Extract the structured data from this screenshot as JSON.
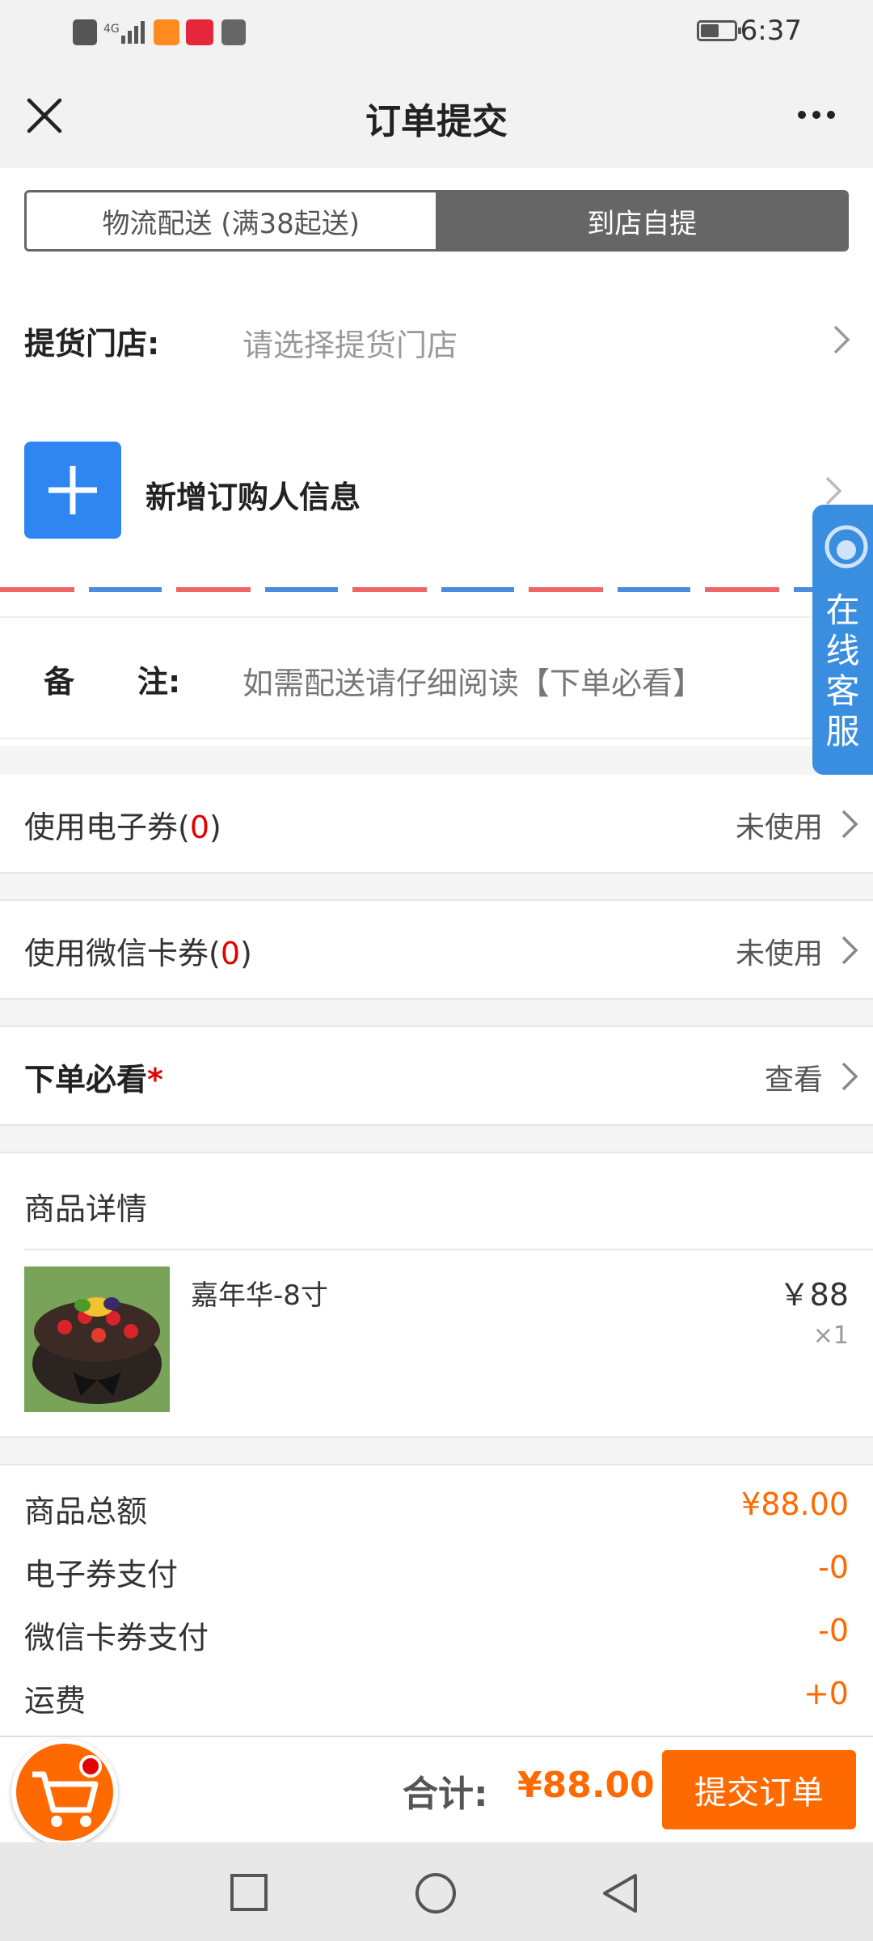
{
  "status_bar": {
    "time": "6:37",
    "icons": [
      "hd-icon",
      "4g-signal-icon",
      "video-app-icon",
      "app-icon",
      "hms-icon",
      "battery-icon"
    ]
  },
  "header": {
    "title": "订单提交",
    "close_icon": "close-icon",
    "more_icon": "more-icon"
  },
  "delivery_tabs": {
    "delivery": "物流配送 (满38起送)",
    "pickup": "到店自提",
    "selected": "pickup"
  },
  "pickup_store": {
    "label": "提货门店:",
    "placeholder": "请选择提货门店"
  },
  "buyer": {
    "label": "新增订购人信息"
  },
  "remark": {
    "label_a": "备",
    "label_b": "注:",
    "placeholder": "如需配送请仔细阅读【下单必看】"
  },
  "coupons": [
    {
      "label": "使用电子券(",
      "count": "0",
      "close": ")",
      "status": "未使用"
    },
    {
      "label": "使用微信卡券(",
      "count": "0",
      "close": ")",
      "status": "未使用"
    }
  ],
  "must_read": {
    "label": "下单必看",
    "required_mark": "*",
    "action": "查看"
  },
  "product_section": {
    "title": "商品详情",
    "items": [
      {
        "name": "嘉年华-8寸",
        "price": "￥88",
        "qty": "×1"
      }
    ]
  },
  "summary": [
    {
      "label": "商品总额",
      "value": "¥88.00"
    },
    {
      "label": "电子券支付",
      "value": "-0"
    },
    {
      "label": "微信卡券支付",
      "value": "-0"
    },
    {
      "label": "运费",
      "value": "+0"
    }
  ],
  "customer_service": {
    "label": "在线客服"
  },
  "bottom_bar": {
    "total_label": "合计:",
    "total_value": "¥88.00",
    "submit": "提交订单"
  },
  "colors": {
    "accent": "#ff6a00",
    "blue": "#3a8ee0",
    "required": "#e20000"
  }
}
